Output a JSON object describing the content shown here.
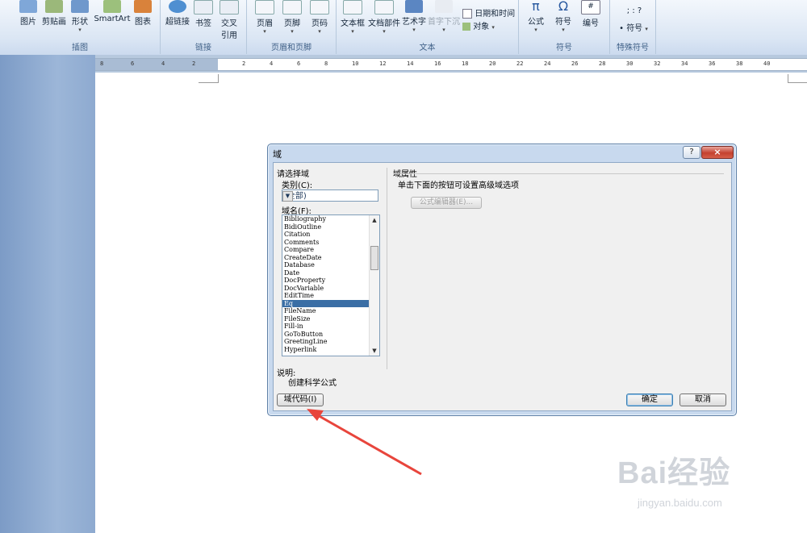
{
  "ribbon": {
    "groups": [
      {
        "label": "插图",
        "buttons": [
          "图片",
          "剪贴画",
          "形状",
          "SmartArt",
          "图表"
        ]
      },
      {
        "label": "链接",
        "buttons": [
          "超链接",
          "书签",
          "交叉引用"
        ]
      },
      {
        "label": "页眉和页脚",
        "buttons": [
          "页眉",
          "页脚",
          "页码"
        ]
      },
      {
        "label": "文本",
        "buttons": [
          "文本框",
          "文档部件",
          "艺术字",
          "首字下沉"
        ],
        "side": [
          "日期和时间",
          "对象"
        ]
      },
      {
        "label": "符号",
        "buttons": [
          "公式",
          "符号",
          "编号"
        ]
      },
      {
        "label": "特殊符号",
        "buttons": [
          "符号"
        ],
        "glyphs": "; : ?"
      }
    ],
    "accent": "#dbe6f4"
  },
  "ruler": {
    "ticks": [
      "8",
      "6",
      "4",
      "2",
      "2",
      "4",
      "6",
      "8",
      "10",
      "12",
      "14",
      "16",
      "18",
      "20",
      "22",
      "24",
      "26",
      "28",
      "30",
      "32",
      "34",
      "36",
      "38",
      "40"
    ]
  },
  "dialog": {
    "title": "域",
    "help": "?",
    "close": "×",
    "choose_field": "请选择域",
    "category_label": "类别(C):",
    "category_value": "(全部)",
    "field_names_label": "域名(F):",
    "field_names": [
      "Bibliography",
      "BidiOutline",
      "Citation",
      "Comments",
      "Compare",
      "CreateDate",
      "Database",
      "Date",
      "DocProperty",
      "DocVariable",
      "EditTime",
      "Eq",
      "FileName",
      "FileSize",
      "Fill-in",
      "GoToButton",
      "GreetingLine",
      "Hyperlink"
    ],
    "selected_field": "Eq",
    "properties_label": "域属性",
    "properties_hint": "单击下面的按钮可设置高级域选项",
    "equation_editor_button": "公式编辑器(E)...",
    "description_label": "说明:",
    "description_text": "创建科学公式",
    "field_codes_button": "域代码(I)",
    "ok_button": "确定",
    "cancel_button": "取消"
  },
  "watermark": {
    "text": "Bai经验",
    "url_text": "jingyan.baidu.com"
  },
  "colors": {
    "arrow": "#e8453c",
    "selection": "#3a6ea5"
  }
}
